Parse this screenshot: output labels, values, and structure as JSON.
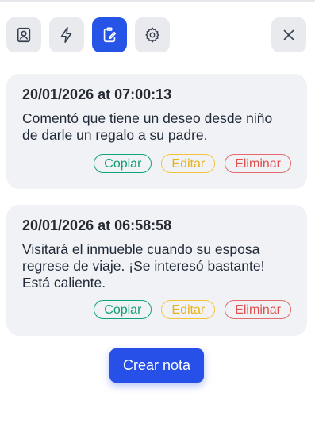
{
  "toolbar": {
    "buttons": [
      {
        "icon": "contact-card-icon",
        "active": false
      },
      {
        "icon": "lightning-icon",
        "active": false
      },
      {
        "icon": "clipboard-edit-icon",
        "active": true
      },
      {
        "icon": "gear-icon",
        "active": false
      }
    ],
    "close_icon": "close-icon"
  },
  "notes": [
    {
      "date": "20/01/2026 at 07:00:13",
      "text": "Comentó que tiene un deseo desde niño de darle un regalo a su padre."
    },
    {
      "date": "20/01/2026 at 06:58:58",
      "text": "Visitará el inmueble cuando su esposa regrese de viaje. ¡Se interesó bastante! Está caliente."
    }
  ],
  "actions": {
    "copy": "Copiar",
    "edit": "Editar",
    "delete": "Eliminar"
  },
  "create_button": "Crear nota",
  "colors": {
    "accent": "#2650e8",
    "copy": "#10a37f",
    "edit": "#f4c23a",
    "delete": "#e36b6b",
    "card_bg": "#f1f2f5"
  }
}
